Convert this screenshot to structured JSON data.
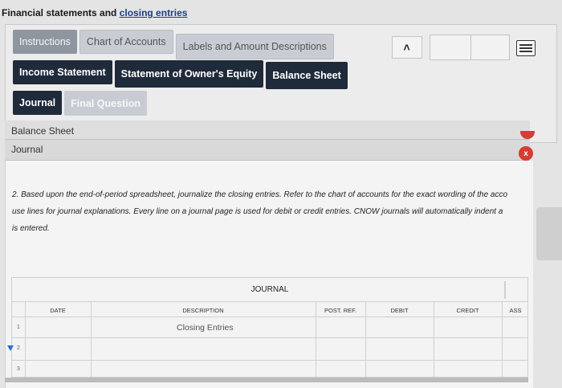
{
  "page": {
    "title_prefix": "Financial statements and",
    "title_link": "closing entries"
  },
  "tabs_row1": [
    "Instructions",
    "Chart of Accounts",
    "Labels and Amount Descriptions"
  ],
  "tabs_row2": [
    "Income Statement",
    "Statement of Owner's Equity",
    "Balance Sheet"
  ],
  "tabs_row3": [
    "Journal",
    "Final Question"
  ],
  "nav": {
    "prev_glyph": "<"
  },
  "sections": {
    "balance_sheet": "Balance Sheet",
    "journal": "Journal",
    "close_glyph": "x"
  },
  "instructions": {
    "line1": "2. Based upon the end-of-period spreadsheet, journalize the closing entries. Refer to the chart of accounts for the exact wording of the acco",
    "line2": "use lines for journal explanations. Every line on a journal page is used for debit or credit entries. CNOW journals will automatically indent a",
    "line3": "is entered."
  },
  "journal": {
    "title": "JOURNAL",
    "columns": [
      "DATE",
      "DESCRIPTION",
      "POST. REF.",
      "DEBIT",
      "CREDIT",
      "ASS"
    ],
    "rows": [
      {
        "num": "1",
        "description": "Closing Entries"
      },
      {
        "num": "2",
        "description": ""
      },
      {
        "num": "3",
        "description": ""
      }
    ]
  },
  "colors": {
    "tab_dark": "#1f2a3a",
    "tab_grey": "#8f96a0",
    "badge_red": "#d53c32",
    "link_blue": "#1a3d8f"
  }
}
